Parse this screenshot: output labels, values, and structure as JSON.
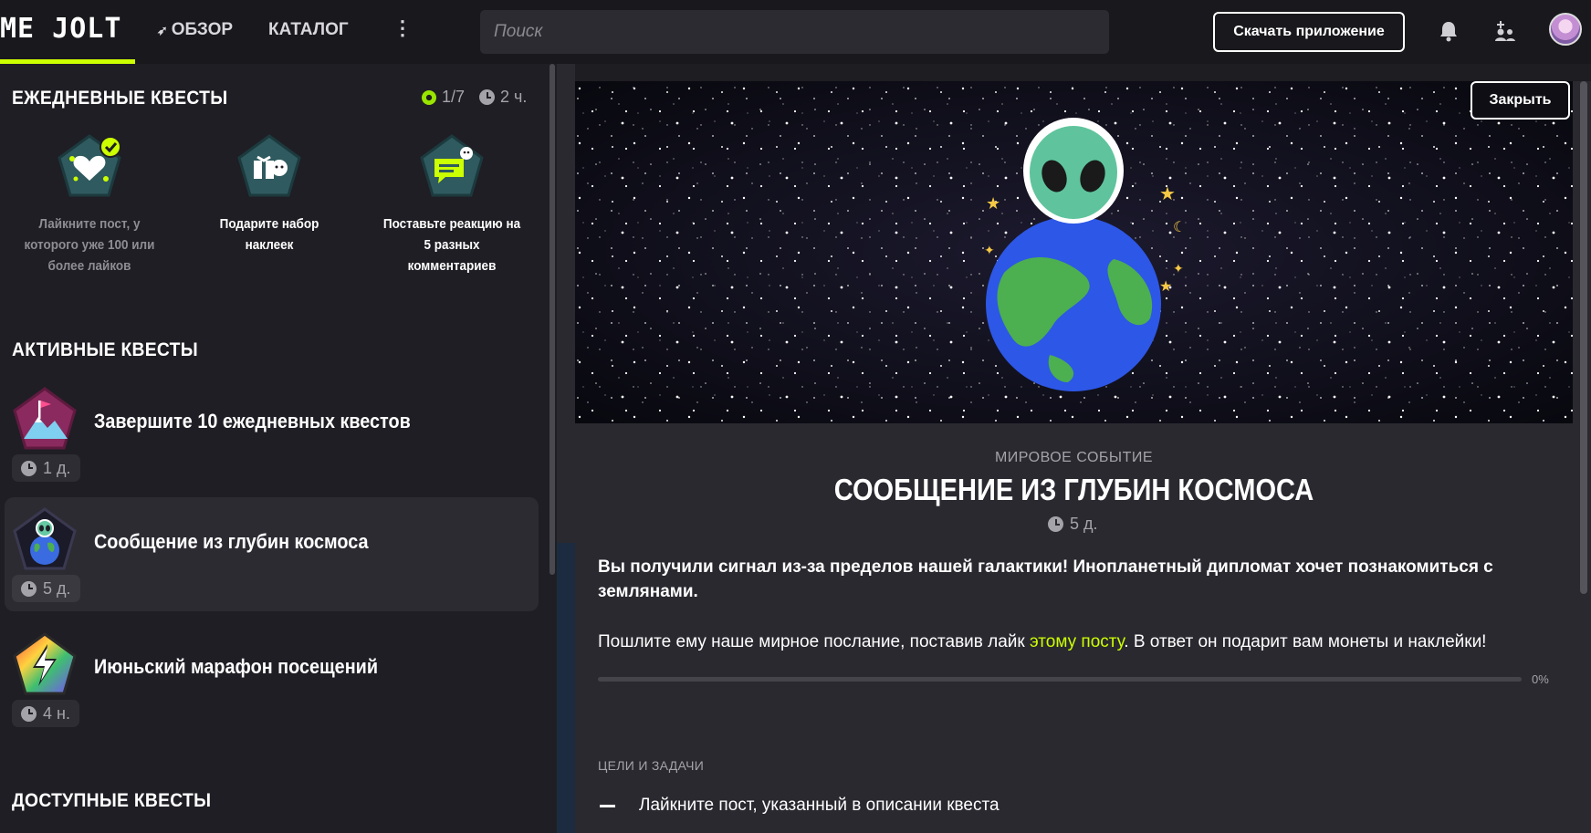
{
  "header": {
    "logo_text": "ME JOLT",
    "nav": {
      "overview": "ОБЗОР",
      "catalog": "КАТАЛОГ"
    },
    "search_placeholder": "Поиск",
    "download_label": "Скачать приложение"
  },
  "daily": {
    "title": "ЕЖЕДНЕВНЫЕ КВЕСТЫ",
    "progress": "1/7",
    "time_left": "2 ч.",
    "quests": [
      {
        "text": "Лайкните пост, у которого уже 100 или более лайков",
        "completed": true
      },
      {
        "text": "Подарите набор наклеек",
        "completed": false
      },
      {
        "text": "Поставьте реакцию на 5 разных комментариев",
        "completed": false
      }
    ]
  },
  "active": {
    "title": "АКТИВНЫЕ КВЕСТЫ",
    "quests": [
      {
        "title": "Завершите 10 ежедневных квестов",
        "time": "1 д."
      },
      {
        "title": "Сообщение из глубин космоса",
        "time": "5 д.",
        "selected": true
      },
      {
        "title": "Июньский марафон посещений",
        "time": "4 н."
      }
    ]
  },
  "available": {
    "title": "ДОСТУПНЫЕ КВЕСТЫ"
  },
  "modal": {
    "close_label": "Закрыть",
    "event_label": "МИРОВОЕ СОБЫТИЕ",
    "title": "СООБЩЕНИЕ ИЗ ГЛУБИН КОСМОСА",
    "time": "5 д.",
    "description_bold": "Вы получили сигнал из-за пределов нашей галактики! Инопланетный дипломат хочет познакомиться с землянами.",
    "description_pre": "Пошлите ему наше мирное послание, поставив лайк ",
    "description_link": "этому посту",
    "description_post": ". В ответ он подарит вам монеты и наклейки!",
    "progress": 0,
    "progress_label": "0%",
    "goals_label": "ЦЕЛИ И ЗАДАЧИ",
    "goals": [
      "Лайкните пост, указанный в описании квеста"
    ]
  },
  "colors": {
    "accent": "#ccff00",
    "background": "#1f1e24",
    "panel": "#2a2930"
  }
}
